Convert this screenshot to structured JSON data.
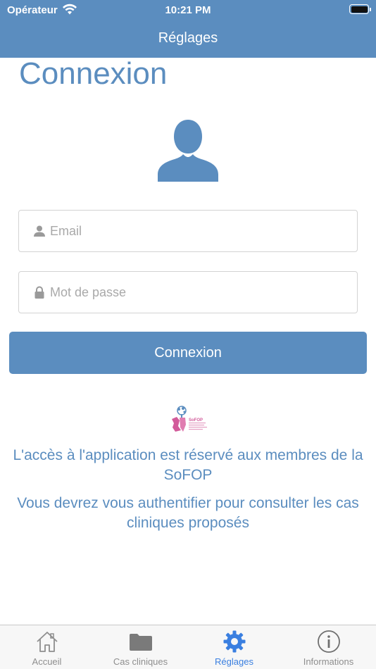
{
  "status_bar": {
    "carrier": "Opérateur",
    "time": "10:21 PM"
  },
  "nav": {
    "title": "Réglages"
  },
  "page": {
    "title": "Connexion"
  },
  "form": {
    "email_placeholder": "Email",
    "password_placeholder": "Mot de passe",
    "login_button": "Connexion"
  },
  "logo": {
    "text": "SoFOP"
  },
  "messages": {
    "access_notice": "L'accès à l'application est réservé aux membres de la SoFOP",
    "auth_notice": "Vous devrez vous authentifier pour consulter les cas cliniques proposés"
  },
  "tabbar": {
    "items": [
      {
        "label": "Accueil",
        "icon": "home-icon",
        "active": false
      },
      {
        "label": "Cas cliniques",
        "icon": "folder-icon",
        "active": false
      },
      {
        "label": "Réglages",
        "icon": "gear-icon",
        "active": true
      },
      {
        "label": "Informations",
        "icon": "info-icon",
        "active": false
      }
    ]
  },
  "colors": {
    "accent": "#5b8dbf",
    "active_tab": "#3a7fe0",
    "inactive_tab": "#8e8e8e",
    "logo_pink": "#d25b9a"
  }
}
